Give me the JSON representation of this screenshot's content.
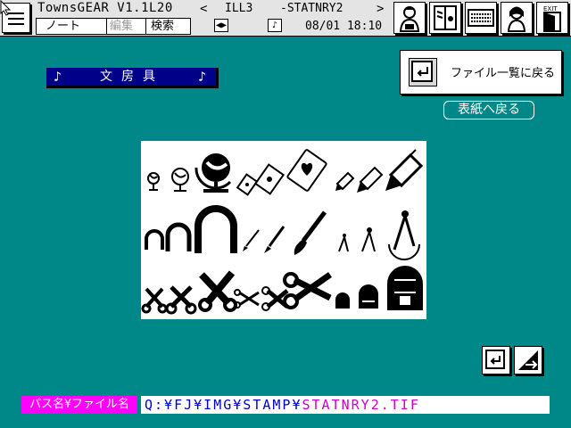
{
  "app": {
    "title": "TownsGEAR V1.1L20",
    "menu": [
      "ノート",
      "編集",
      "検索"
    ],
    "ill_label": "ILL3",
    "file_label": "-STATNRY2",
    "datetime": "08/01 18:10",
    "nav_prev": "<",
    "nav_next": ">"
  },
  "category": {
    "title": "文房具",
    "note_icon": "♪"
  },
  "buttons": {
    "back_to_list": "ファイル一覧に戻る",
    "back_to_cover": "表紙へ戻る"
  },
  "path": {
    "label": "パス名¥ファイル名",
    "directory": "Q:¥FJ¥IMG¥STAMP¥",
    "filename": "STATNRY2.TIF"
  },
  "icons": {
    "toolbar": [
      "person-icon",
      "book-icon",
      "keyboard-icon",
      "lady-icon",
      "exit-icon"
    ],
    "stamps": [
      "globe-icon",
      "card-icon",
      "pencil-icon",
      "magnet-icon",
      "brush-icon",
      "compass-icon",
      "scissors-icon",
      "bag-icon"
    ]
  }
}
